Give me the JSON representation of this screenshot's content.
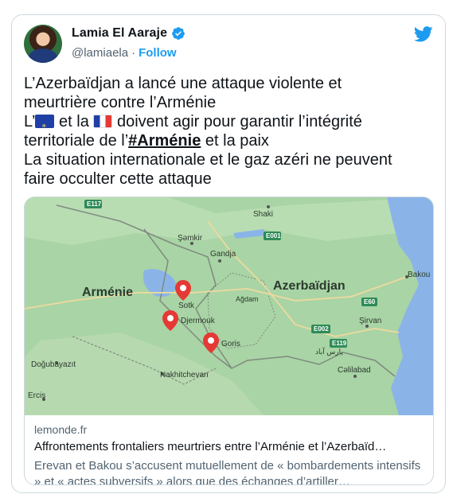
{
  "author": {
    "name": "Lamia El Aaraje",
    "handle": "@lamiaela",
    "separator": "·",
    "follow_label": "Follow"
  },
  "icons": {
    "verified": "verified-badge-icon",
    "twitter": "twitter-bird-icon",
    "eu_flag": "eu-flag-emoji",
    "fr_flag": "france-flag-emoji",
    "pin": "map-pin-icon"
  },
  "tweet": {
    "line1": "L’Azerbaïdjan a lancé une attaque violente et",
    "line2": "meurtrière contre l’Arménie",
    "line3_prefix": "L’",
    "line3_mid": " et la ",
    "line3_suffix": " doivent agir pour garantir l’intégrité",
    "line4_prefix": "territoriale de l’",
    "hashtag": "#Arménie",
    "line4_suffix": " et la paix",
    "line5": "La situation internationale et le gaz azéri ne peuvent",
    "line6": "faire occulter cette attaque"
  },
  "map": {
    "countries": [
      "Arménie",
      "Azerbaïdjan"
    ],
    "cities": [
      "Shaki",
      "Şəmkir",
      "Gandja",
      "Sotk",
      "Djermouk",
      "Goris",
      "Ağdam",
      "Nakhitchevan",
      "Doğubayazıt",
      "Erciş",
      "Bakou",
      "Şirvan",
      "Cəlilabad"
    ],
    "roads": [
      "E117",
      "E001",
      "E60",
      "E002",
      "E119"
    ],
    "other_labels": [
      "Ağdam",
      "Ağdam",
      "پارس آباد"
    ],
    "colors": {
      "land": "#a9d4a5",
      "water": "#8ab4e8",
      "border": "#7f8a80",
      "pin": "#e53935",
      "road_badge": "#2e8b57"
    }
  },
  "link": {
    "domain": "lemonde.fr",
    "headline": "Affrontements frontaliers meurtriers entre l’Arménie et l’Azerbaïd…",
    "description": "Erevan et Bakou s’accusent mutuellement de « bombardements intensifs » et « actes subversifs » alors que des échanges d’artiller…"
  }
}
